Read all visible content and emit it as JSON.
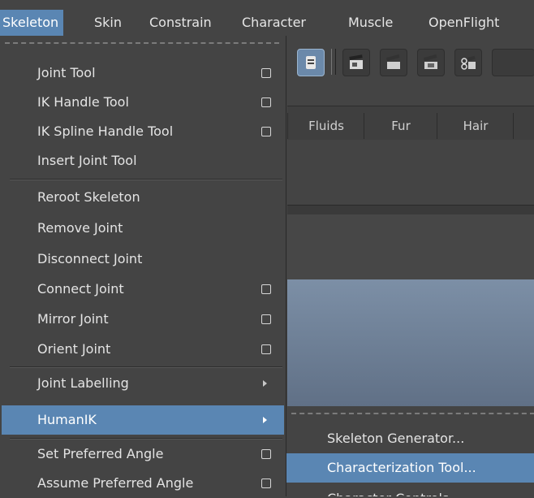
{
  "menubar": {
    "items": [
      {
        "label": "Skeleton"
      },
      {
        "label": "Skin"
      },
      {
        "label": "Constrain"
      },
      {
        "label": "Character"
      },
      {
        "label": "Muscle"
      },
      {
        "label": "OpenFlight"
      }
    ]
  },
  "shelf": {
    "tabs": [
      {
        "label": "Fluids"
      },
      {
        "label": "Fur"
      },
      {
        "label": "Hair"
      }
    ]
  },
  "skeleton_menu": {
    "items": [
      {
        "label": "Joint Tool"
      },
      {
        "label": "IK Handle Tool"
      },
      {
        "label": "IK Spline Handle Tool"
      },
      {
        "label": "Insert Joint Tool"
      },
      {
        "label": "Reroot Skeleton"
      },
      {
        "label": "Remove Joint"
      },
      {
        "label": "Disconnect Joint"
      },
      {
        "label": "Connect Joint"
      },
      {
        "label": "Mirror Joint"
      },
      {
        "label": "Orient Joint"
      },
      {
        "label": "Joint Labelling"
      },
      {
        "label": "HumanIK"
      },
      {
        "label": "Set Preferred Angle"
      },
      {
        "label": "Assume Preferred Angle"
      }
    ]
  },
  "humanik_submenu": {
    "items": [
      {
        "label": "Skeleton Generator..."
      },
      {
        "label": "Characterization Tool..."
      },
      {
        "label": "Character Controls"
      }
    ]
  },
  "colors": {
    "highlight": "#5a86b3",
    "menu_bg": "#444444",
    "viewport_top": "#7c8fa6",
    "viewport_bottom": "#607086"
  }
}
